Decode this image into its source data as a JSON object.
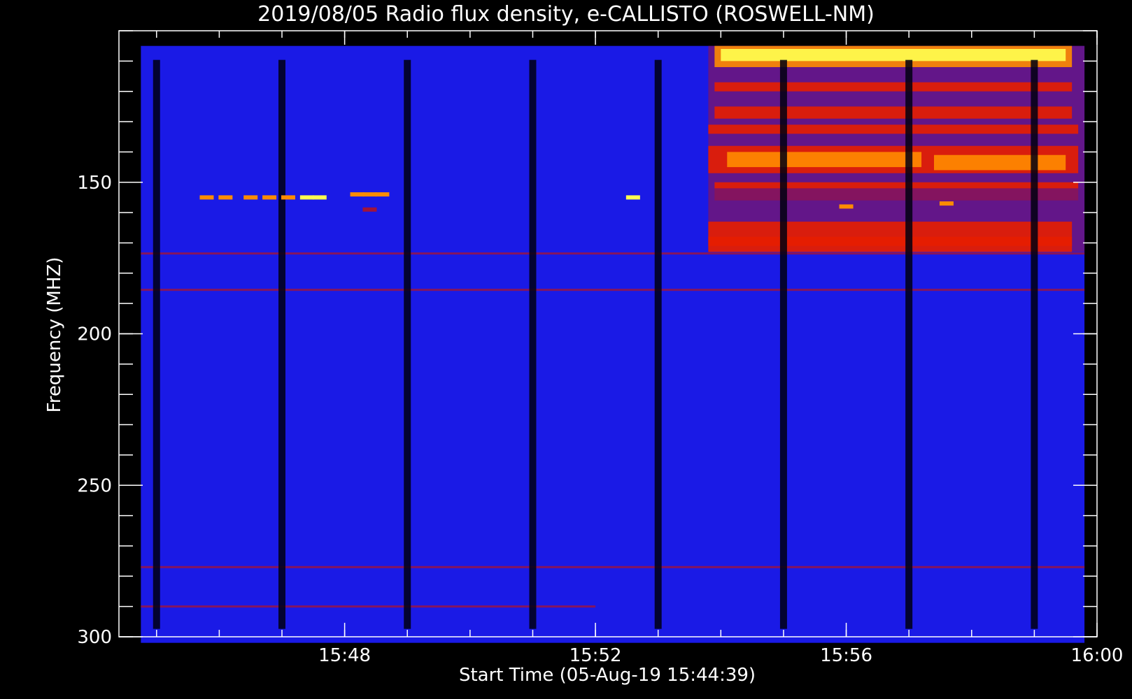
{
  "chart_data": {
    "type": "heatmap",
    "title": "2019/08/05  Radio flux density, e-CALLISTO (ROSWELL-NM)",
    "xlabel": "Start Time (05-Aug-19 15:44:39)",
    "ylabel": "Frequency (MHZ)",
    "x_unit": "minutes after 15:44",
    "xlim": [
      0.4,
      16.0
    ],
    "ylim": [
      300,
      100
    ],
    "x_ticks": [
      {
        "x": 4,
        "label": "15:48"
      },
      {
        "x": 8,
        "label": "15:52"
      },
      {
        "x": 12,
        "label": "15:56"
      },
      {
        "x": 16,
        "label": "16:00"
      }
    ],
    "x_minor_step": 1,
    "y_ticks": [
      {
        "y": 150,
        "label": "150"
      },
      {
        "y": 200,
        "label": "200"
      },
      {
        "y": 250,
        "label": "250"
      },
      {
        "y": 300,
        "label": "300"
      }
    ],
    "y_minor_step": 10,
    "data_extent": {
      "x": [
        0.75,
        15.8
      ],
      "y": [
        105,
        302
      ]
    },
    "colors": {
      "background_signal": "#1a1ae6",
      "gap": "#000010",
      "weak": "#a0143c",
      "moderate": "#e61e00",
      "strong": "#ff8c00",
      "intense": "#ffff50",
      "axis": "#ffffff"
    },
    "calibration_gaps": [
      1.0,
      3.0,
      5.0,
      7.0,
      9.0,
      11.0,
      13.0,
      15.0
    ],
    "interference_lines": [
      {
        "freq": 173.5,
        "x": [
          0.75,
          15.8
        ],
        "level": "weak"
      },
      {
        "freq": 185.5,
        "x": [
          0.75,
          15.8
        ],
        "level": "weak"
      },
      {
        "freq": 277.0,
        "x": [
          0.75,
          15.8
        ],
        "level": "weak"
      },
      {
        "freq": 290.0,
        "x": [
          0.75,
          8.0
        ],
        "level": "weak"
      }
    ],
    "burst_regions": [
      {
        "x": [
          9.8,
          15.8
        ],
        "freq": [
          105,
          173
        ],
        "level": "weak"
      },
      {
        "x": [
          9.9,
          15.6
        ],
        "freq": [
          105,
          112
        ],
        "level": "strong"
      },
      {
        "x": [
          10.0,
          15.5
        ],
        "freq": [
          106,
          110
        ],
        "level": "intense"
      },
      {
        "x": [
          9.9,
          15.6
        ],
        "freq": [
          117,
          120
        ],
        "level": "moderate"
      },
      {
        "x": [
          9.9,
          15.6
        ],
        "freq": [
          125,
          129
        ],
        "level": "moderate"
      },
      {
        "x": [
          9.8,
          15.7
        ],
        "freq": [
          131,
          134
        ],
        "level": "moderate"
      },
      {
        "x": [
          9.8,
          15.7
        ],
        "freq": [
          138,
          147
        ],
        "level": "moderate"
      },
      {
        "x": [
          10.1,
          13.2
        ],
        "freq": [
          140,
          145
        ],
        "level": "strong"
      },
      {
        "x": [
          13.4,
          15.5
        ],
        "freq": [
          141,
          146
        ],
        "level": "strong"
      },
      {
        "x": [
          9.9,
          15.7
        ],
        "freq": [
          150,
          152
        ],
        "level": "moderate"
      },
      {
        "x": [
          9.9,
          15.7
        ],
        "freq": [
          152,
          156
        ],
        "level": "weak"
      },
      {
        "x": [
          9.8,
          15.6
        ],
        "freq": [
          163,
          173
        ],
        "level": "moderate"
      },
      {
        "x": [
          9.8,
          15.6
        ],
        "freq": [
          168,
          171
        ],
        "level": "moderate"
      }
    ],
    "spot_events": [
      {
        "x": 1.8,
        "freq": 155,
        "level": "strong"
      },
      {
        "x": 2.1,
        "freq": 155,
        "level": "strong"
      },
      {
        "x": 2.5,
        "freq": 155,
        "level": "strong"
      },
      {
        "x": 2.8,
        "freq": 155,
        "level": "strong"
      },
      {
        "x": 3.1,
        "freq": 155,
        "level": "strong"
      },
      {
        "x": 3.4,
        "freq": 155,
        "level": "intense"
      },
      {
        "x": 3.6,
        "freq": 155,
        "level": "intense"
      },
      {
        "x": 4.2,
        "freq": 154,
        "level": "strong"
      },
      {
        "x": 4.4,
        "freq": 154,
        "level": "strong"
      },
      {
        "x": 4.6,
        "freq": 154,
        "level": "strong"
      },
      {
        "x": 4.4,
        "freq": 159,
        "level": "weak"
      },
      {
        "x": 8.6,
        "freq": 155,
        "level": "intense"
      },
      {
        "x": 12.0,
        "freq": 158,
        "level": "strong"
      },
      {
        "x": 13.6,
        "freq": 157,
        "level": "strong"
      }
    ]
  }
}
